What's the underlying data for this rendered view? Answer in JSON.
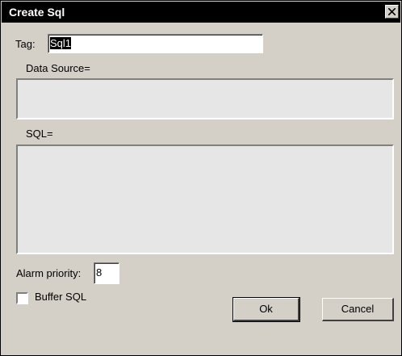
{
  "window": {
    "title": "Create Sql"
  },
  "form": {
    "tag_label": "Tag:",
    "tag_value": "Sql1",
    "data_source_label": "Data Source=",
    "data_source_value": "",
    "sql_label": "SQL=",
    "sql_value": "",
    "alarm_priority_label": "Alarm priority:",
    "alarm_priority_value": "8",
    "buffer_sql_label": "Buffer SQL",
    "buffer_sql_checked": false
  },
  "buttons": {
    "ok_label": "Ok",
    "cancel_label": "Cancel"
  },
  "icons": {
    "close": "close-icon"
  },
  "colors": {
    "titlebar": "#000000",
    "dialog_bg": "#d4d0c8",
    "textarea_bg": "#e6e6e6"
  }
}
